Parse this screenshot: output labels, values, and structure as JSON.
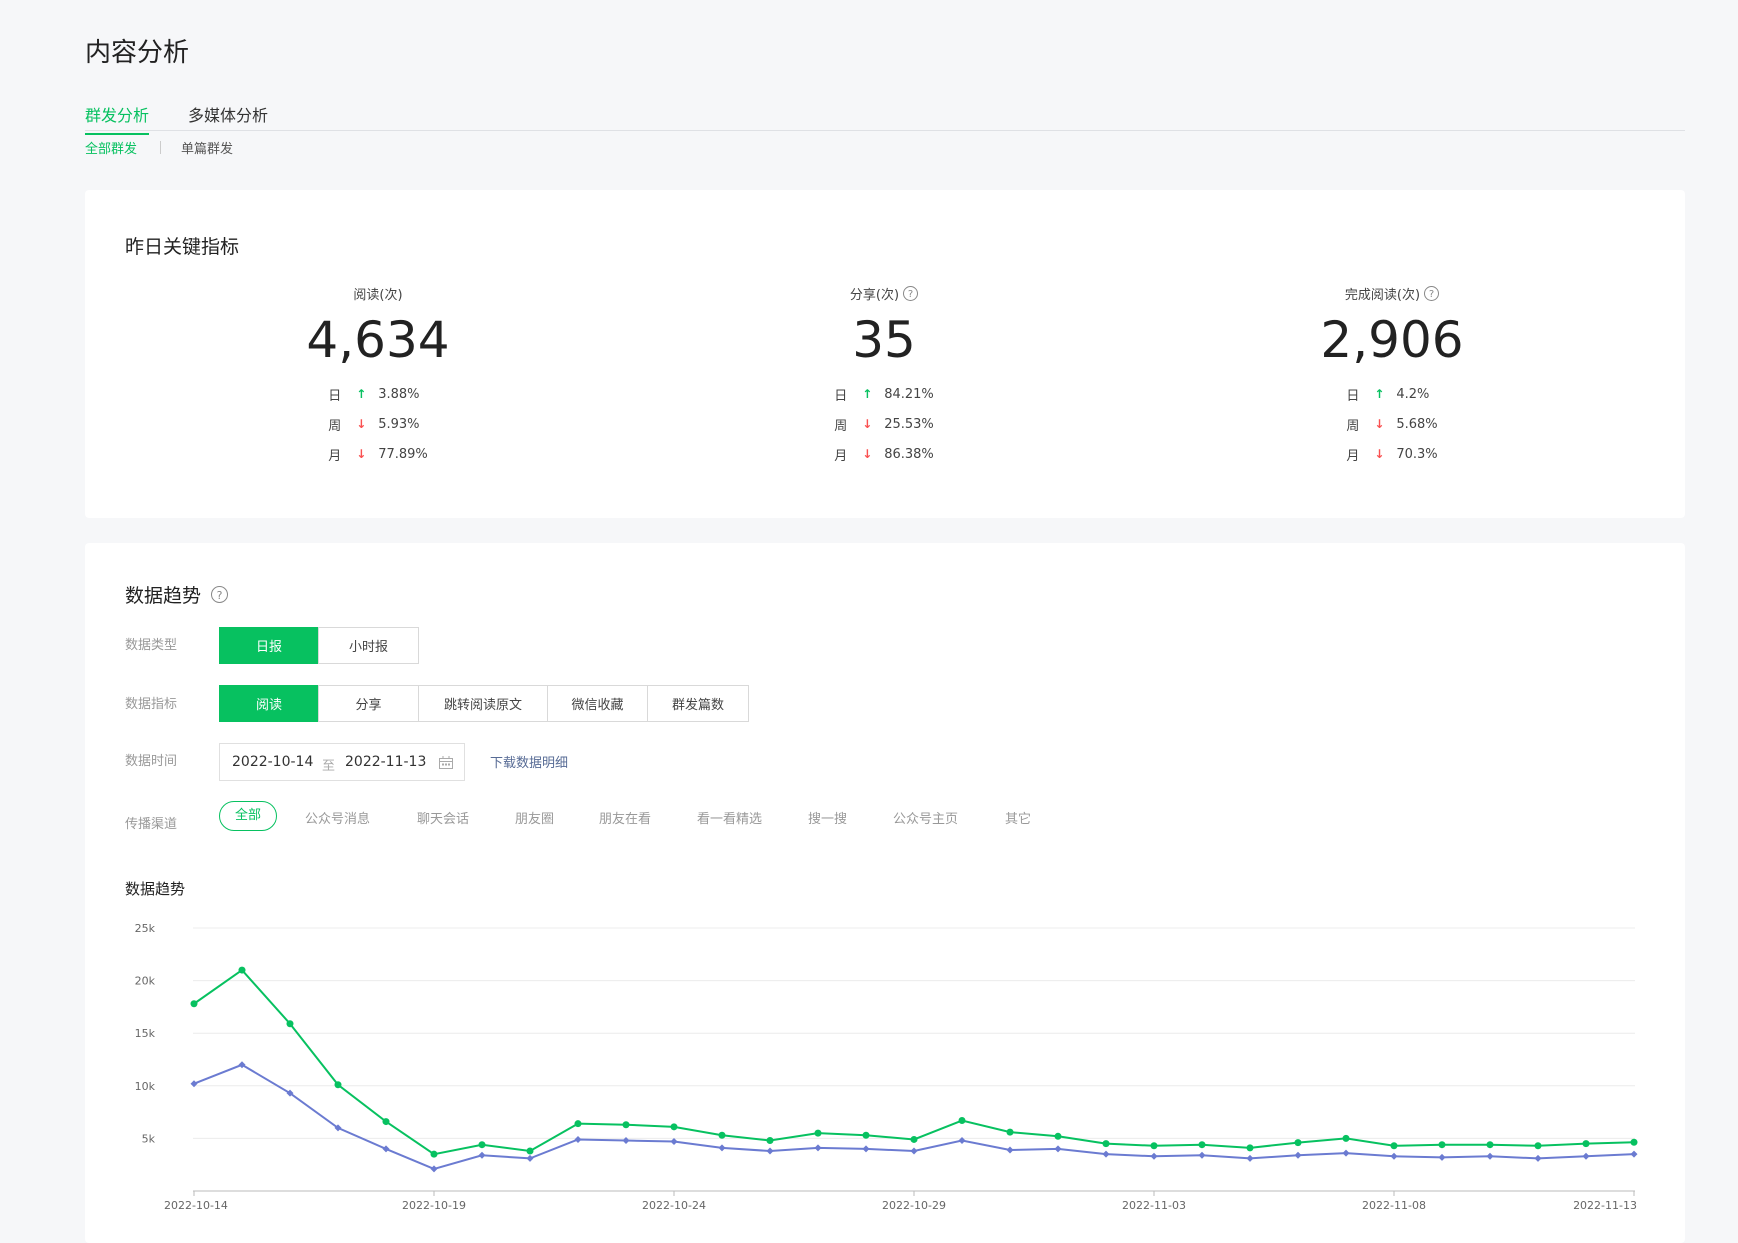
{
  "page": {
    "title": "内容分析"
  },
  "tabs": [
    {
      "label": "群发分析",
      "active": true
    },
    {
      "label": "多媒体分析",
      "active": false
    }
  ],
  "subtabs": [
    {
      "label": "全部群发",
      "active": true
    },
    {
      "label": "单篇群发",
      "active": false
    }
  ],
  "key_metrics": {
    "title": "昨日关键指标",
    "items": [
      {
        "label": "阅读(次)",
        "help": false,
        "value": "4,634",
        "rows": [
          {
            "period": "日",
            "dir": "up",
            "pct": "3.88%"
          },
          {
            "period": "周",
            "dir": "down",
            "pct": "5.93%"
          },
          {
            "period": "月",
            "dir": "down",
            "pct": "77.89%"
          }
        ]
      },
      {
        "label": "分享(次)",
        "help": true,
        "value": "35",
        "rows": [
          {
            "period": "日",
            "dir": "up",
            "pct": "84.21%"
          },
          {
            "period": "周",
            "dir": "down",
            "pct": "25.53%"
          },
          {
            "period": "月",
            "dir": "down",
            "pct": "86.38%"
          }
        ]
      },
      {
        "label": "完成阅读(次)",
        "help": true,
        "value": "2,906",
        "rows": [
          {
            "period": "日",
            "dir": "up",
            "pct": "4.2%"
          },
          {
            "period": "周",
            "dir": "down",
            "pct": "5.68%"
          },
          {
            "period": "月",
            "dir": "down",
            "pct": "70.3%"
          }
        ]
      }
    ]
  },
  "trend": {
    "title": "数据趋势",
    "data_type": {
      "label": "数据类型",
      "options": [
        "日报",
        "小时报"
      ],
      "selected": "日报"
    },
    "metric": {
      "label": "数据指标",
      "options": [
        "阅读",
        "分享",
        "跳转阅读原文",
        "微信收藏",
        "群发篇数"
      ],
      "selected": "阅读"
    },
    "time": {
      "label": "数据时间",
      "start": "2022-10-14",
      "sep": "至",
      "end": "2022-11-13",
      "download": "下载数据明细"
    },
    "channel": {
      "label": "传播渠道",
      "options": [
        "全部",
        "公众号消息",
        "聊天会话",
        "朋友圈",
        "朋友在看",
        "看一看精选",
        "搜一搜",
        "公众号主页",
        "其它"
      ],
      "selected": "全部"
    },
    "chart_title": "数据趋势"
  },
  "colors": {
    "accent": "#07c160",
    "secondary": "#6b7bd1",
    "down": "#fa5151",
    "link": "#576b95"
  },
  "chart_data": {
    "type": "line",
    "yticks": [
      "5k",
      "10k",
      "15k",
      "20k",
      "25k"
    ],
    "ylim": [
      0,
      25000
    ],
    "xticks": [
      "2022-10-14",
      "2022-10-19",
      "2022-10-24",
      "2022-10-29",
      "2022-11-03",
      "2022-11-08",
      "2022-11-13"
    ],
    "grid": true,
    "x": [
      "2022-10-14",
      "2022-10-15",
      "2022-10-16",
      "2022-10-17",
      "2022-10-18",
      "2022-10-19",
      "2022-10-20",
      "2022-10-21",
      "2022-10-22",
      "2022-10-23",
      "2022-10-24",
      "2022-10-25",
      "2022-10-26",
      "2022-10-27",
      "2022-10-28",
      "2022-10-29",
      "2022-10-30",
      "2022-10-31",
      "2022-11-01",
      "2022-11-02",
      "2022-11-03",
      "2022-11-04",
      "2022-11-05",
      "2022-11-06",
      "2022-11-07",
      "2022-11-08",
      "2022-11-09",
      "2022-11-10",
      "2022-11-11",
      "2022-11-12",
      "2022-11-13"
    ],
    "series": [
      {
        "color": "#07c160",
        "values": [
          17800,
          21000,
          15900,
          10100,
          6600,
          3500,
          4400,
          3800,
          6400,
          6300,
          6100,
          5300,
          4800,
          5500,
          5300,
          4900,
          6700,
          5600,
          5200,
          4500,
          4300,
          4400,
          4100,
          4600,
          5000,
          4300,
          4400,
          4400,
          4300,
          4500,
          4634
        ]
      },
      {
        "color": "#6b7bd1",
        "values": [
          10200,
          12000,
          9300,
          6000,
          4000,
          2100,
          3400,
          3100,
          4900,
          4800,
          4700,
          4100,
          3800,
          4100,
          4000,
          3800,
          4800,
          3900,
          4000,
          3500,
          3300,
          3400,
          3100,
          3400,
          3600,
          3300,
          3200,
          3300,
          3100,
          3300,
          3500
        ]
      }
    ]
  }
}
